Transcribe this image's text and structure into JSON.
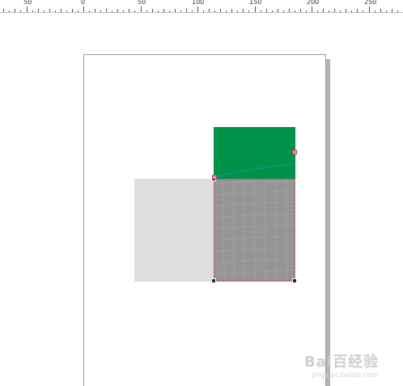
{
  "ruler": {
    "labels": [
      "50",
      "0",
      "50",
      "100",
      "150",
      "200",
      "250"
    ]
  },
  "watermark": {
    "brand": "Bai百经验",
    "url": "jingyan.baidu.com"
  },
  "colors": {
    "green_fill": "#00914b",
    "gray_fill": "#959595",
    "light_fill": "#dededc",
    "selection": "#d0506a"
  }
}
